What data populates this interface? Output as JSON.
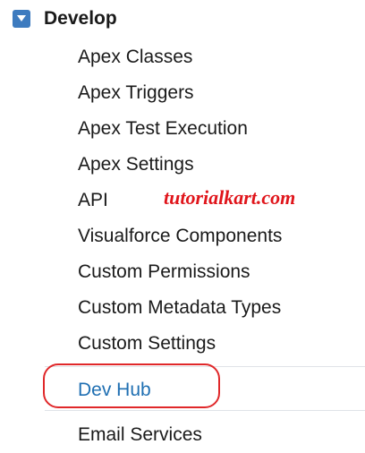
{
  "section": {
    "title": "Develop",
    "expanded": true,
    "toggle_icon": "caret-down-icon",
    "toggle_color": "#3d7bbf"
  },
  "items": [
    {
      "label": "Apex Classes"
    },
    {
      "label": "Apex Triggers"
    },
    {
      "label": "Apex Test Execution"
    },
    {
      "label": "Apex Settings"
    },
    {
      "label": "API"
    },
    {
      "label": "Visualforce Components"
    },
    {
      "label": "Custom Permissions"
    },
    {
      "label": "Custom Metadata Types"
    },
    {
      "label": "Custom Settings"
    },
    {
      "label": "Dev Hub",
      "selected": true
    },
    {
      "label": "Email Services"
    }
  ],
  "watermark": {
    "text": "tutorialkart.com",
    "color": "#e0151b"
  },
  "highlight_color": "#e0282a",
  "selected_link_color": "#1f6fb2"
}
